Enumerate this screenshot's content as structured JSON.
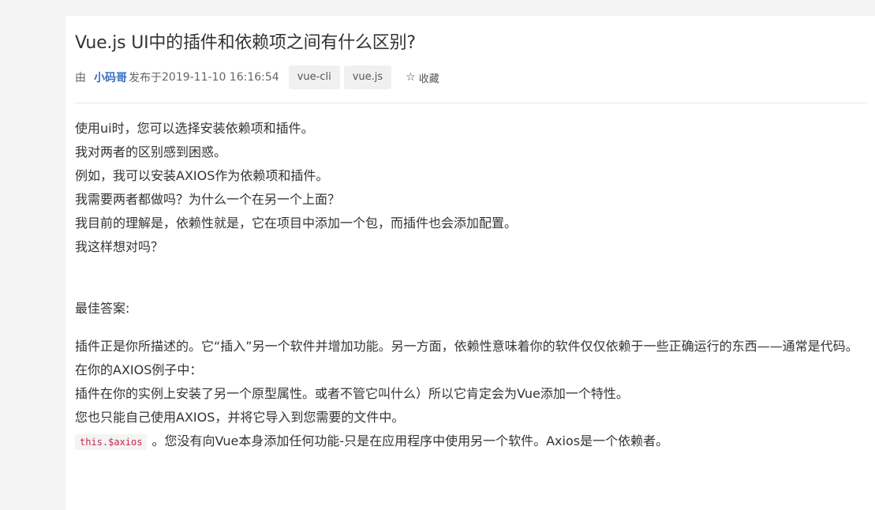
{
  "article": {
    "title": "Vue.js UI中的插件和依赖项之间有什么区别?",
    "meta": {
      "by_label": "由",
      "author": "小码哥",
      "published_label": "发布于",
      "date": "2019-11-10 16:16:54",
      "tags": [
        "vue-cli",
        "vue.js"
      ],
      "favorite_label": "收藏"
    },
    "question_lines": [
      "使用ui时，您可以选择安装依赖项和插件。",
      "我对两者的区别感到困惑。",
      "例如，我可以安装AXIOS作为依赖项和插件。",
      "我需要两者都做吗？为什么一个在另一个上面？",
      "我目前的理解是，依赖性就是，它在项目中添加一个包，而插件也会添加配置。",
      "我这样想对吗？"
    ],
    "answer_heading": "最佳答案:",
    "answer_paragraph": "插件正是你所描述的。它“插入”另一个软件并增加功能。另一方面，依赖性意味着你的软件仅仅依赖于一些正确运行的东西——通常是代码。",
    "answer_lines": [
      "在你的AXIOS例子中：",
      "插件在你的实例上安装了另一个原型属性。或者不管它叫什么）所以它肯定会为Vue添加一个特性。",
      "您也只能自己使用AXIOS，并将它导入到您需要的文件中。"
    ],
    "answer_code": "this.$axios",
    "answer_last_line": "。您没有向Vue本身添加任何功能-只是在应用程序中使用另一个软件。Axios是一个依赖者。"
  }
}
